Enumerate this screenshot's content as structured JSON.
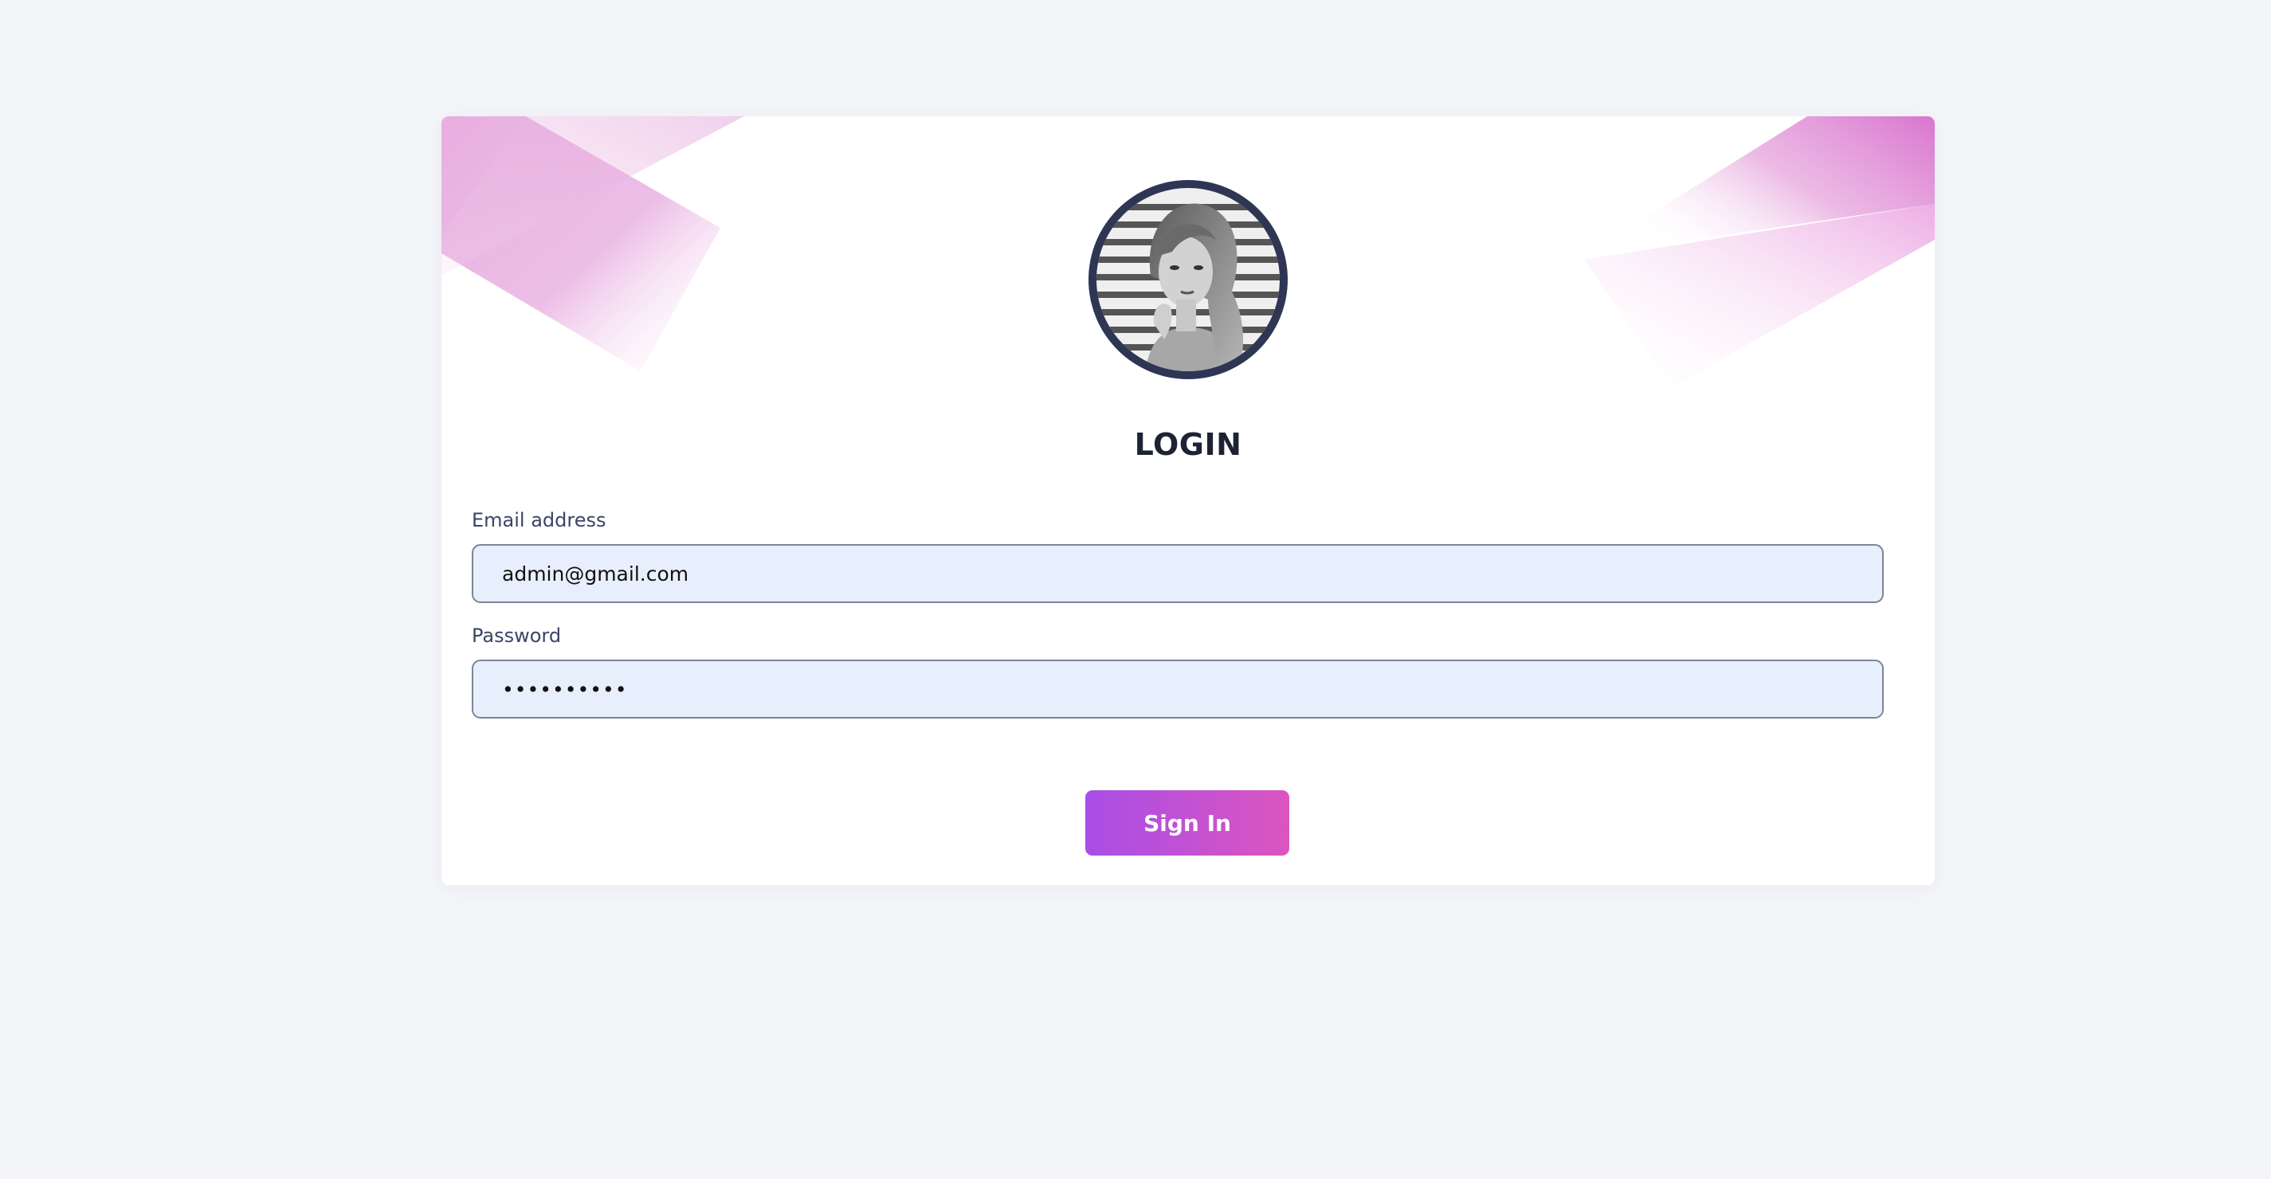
{
  "login": {
    "title": "LOGIN",
    "email": {
      "label": "Email address",
      "value": "admin@gmail.com"
    },
    "password": {
      "label": "Password",
      "value": "••••••••••"
    },
    "sign_in_label": "Sign In"
  },
  "colors": {
    "page_background": "#f4f5f9",
    "card_background": "#ffffff",
    "accent_pink": "#db55c0",
    "accent_purple": "#a94ee6",
    "input_background": "#e8effc",
    "avatar_ring": "#2e3654"
  },
  "icons": {
    "avatar": "user-profile-photo"
  }
}
